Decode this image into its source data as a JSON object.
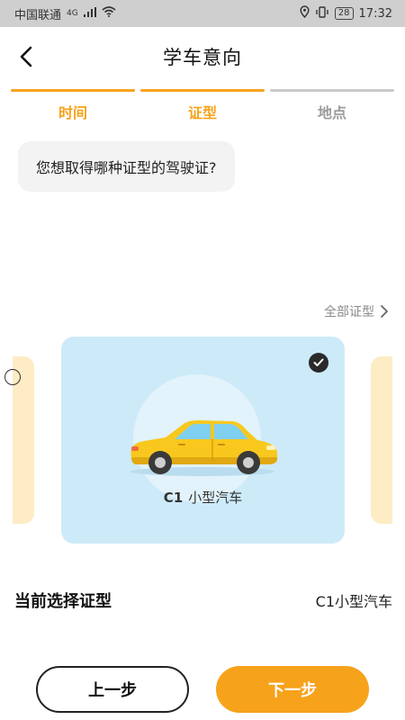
{
  "status_bar": {
    "carrier": "中国联通",
    "network": "4G",
    "battery": "28",
    "time": "17:32"
  },
  "header": {
    "title": "学车意向"
  },
  "steps": [
    {
      "label": "时间",
      "state": "done"
    },
    {
      "label": "证型",
      "state": "active"
    },
    {
      "label": "地点",
      "state": "inactive"
    }
  ],
  "question": "您想取得哪种证型的驾驶证?",
  "all_licenses_link": "全部证型",
  "selected_card": {
    "code": "C1",
    "name": "小型汽车",
    "icon": "yellow-car-icon"
  },
  "current_selection": {
    "title": "当前选择证型",
    "value": "C1小型汽车"
  },
  "buttons": {
    "prev": "上一步",
    "next": "下一步"
  },
  "colors": {
    "accent": "#f7a21b",
    "card_bg": "#cdeaf9",
    "side_card_bg": "#fdecc4",
    "inactive": "#c9c9c9"
  }
}
